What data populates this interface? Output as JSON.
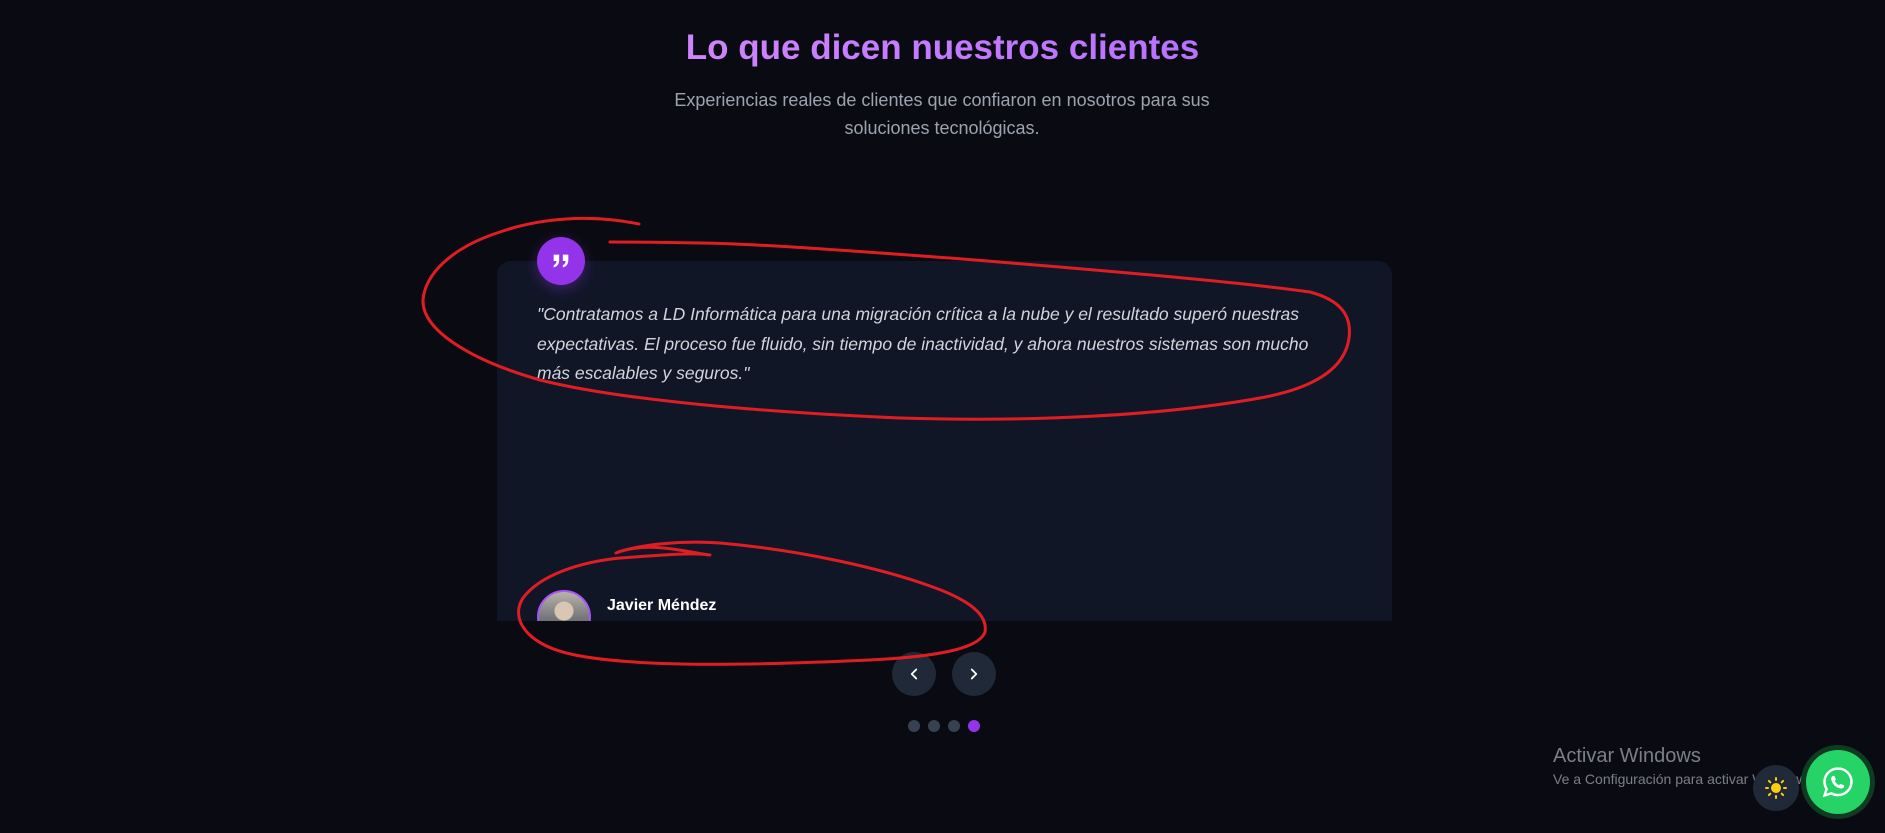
{
  "header": {
    "title": "Lo que dicen nuestros clientes",
    "subtitle": "Experiencias reales de clientes que confiaron en nosotros para sus soluciones tecnológicas."
  },
  "testimonial": {
    "quote": "\"Contratamos a LD Informática para una migración crítica a la nube y el resultado superó nuestras expectativas. El proceso fue fluido, sin tiempo de inactividad, y ahora nuestros sistemas son mucho más escalables y seguros.\"",
    "author": "Javier Méndez"
  },
  "carousel": {
    "dot_count": 4,
    "active_dot": 4
  },
  "windows_watermark": {
    "title": "Activar Windows",
    "subtitle": "Ve a Configuración para activar Windows."
  },
  "icons": {
    "quote": "quote-icon",
    "prev": "chevron-left-icon",
    "next": "chevron-right-icon",
    "theme": "sun-icon",
    "whatsapp": "whatsapp-icon"
  },
  "colors": {
    "accent": "#9333ea",
    "whatsapp": "#25d366",
    "annotation": "#e11d24"
  }
}
